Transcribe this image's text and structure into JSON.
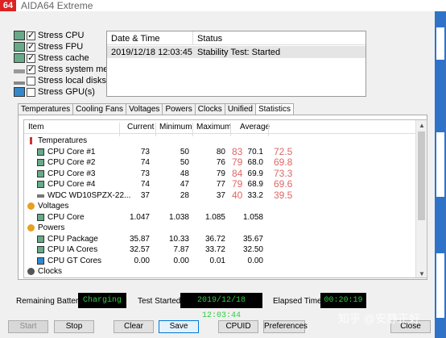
{
  "window": {
    "icon_text": "64",
    "title": "AIDA64 Extreme"
  },
  "stress_options": [
    {
      "label": "Stress CPU",
      "checked": true,
      "device_icon": "cpu-chip-icon"
    },
    {
      "label": "Stress FPU",
      "checked": true,
      "device_icon": "fpu-chip-icon"
    },
    {
      "label": "Stress cache",
      "checked": true,
      "device_icon": "cache-chip-icon"
    },
    {
      "label": "Stress system memory",
      "checked": true,
      "device_icon": "memory-icon"
    },
    {
      "label": "Stress local disks",
      "checked": false,
      "device_icon": "disk-icon"
    },
    {
      "label": "Stress GPU(s)",
      "checked": false,
      "device_icon": "gpu-icon"
    }
  ],
  "log": {
    "col_datetime": "Date & Time",
    "col_status": "Status",
    "rows": [
      {
        "datetime": "2019/12/18 12:03:45",
        "status": "Stability Test: Started"
      }
    ]
  },
  "tabs": [
    "Temperatures",
    "Cooling Fans",
    "Voltages",
    "Powers",
    "Clocks",
    "Unified",
    "Statistics"
  ],
  "active_tab": "Statistics",
  "stats": {
    "columns": {
      "item": "Item",
      "current": "Current",
      "minimum": "Minimum",
      "maximum": "Maximum",
      "average": "Average"
    },
    "rows": [
      {
        "type": "group",
        "name": "Temperatures",
        "icon": "thermometer-icon"
      },
      {
        "type": "item",
        "name": "CPU Core #1",
        "current": "73",
        "min": "50",
        "max": "80",
        "avg": "70.1",
        "note1": "83",
        "note2": "72.5",
        "icon": "cpu-chip-icon"
      },
      {
        "type": "item",
        "name": "CPU Core #2",
        "current": "74",
        "min": "50",
        "max": "76",
        "avg": "68.0",
        "note1": "79",
        "note2": "69.8",
        "icon": "cpu-chip-icon"
      },
      {
        "type": "item",
        "name": "CPU Core #3",
        "current": "73",
        "min": "48",
        "max": "79",
        "avg": "69.9",
        "note1": "84",
        "note2": "73.3",
        "icon": "cpu-chip-icon"
      },
      {
        "type": "item",
        "name": "CPU Core #4",
        "current": "74",
        "min": "47",
        "max": "77",
        "avg": "68.9",
        "note1": "79",
        "note2": "69.6",
        "icon": "cpu-chip-icon"
      },
      {
        "type": "item",
        "name": "WDC WD10SPZX-22...",
        "current": "37",
        "min": "28",
        "max": "37",
        "avg": "33.2",
        "note1": "40",
        "note2": "39.5",
        "icon": "disk-icon"
      },
      {
        "type": "group",
        "name": "Voltages",
        "icon": "voltage-icon"
      },
      {
        "type": "item",
        "name": "CPU Core",
        "current": "1.047",
        "min": "1.038",
        "max": "1.085",
        "avg": "1.058",
        "icon": "cpu-chip-icon"
      },
      {
        "type": "group",
        "name": "Powers",
        "icon": "power-icon"
      },
      {
        "type": "item",
        "name": "CPU Package",
        "current": "35.87",
        "min": "10.33",
        "max": "36.72",
        "avg": "35.67",
        "icon": "cpu-chip-icon"
      },
      {
        "type": "item",
        "name": "CPU IA Cores",
        "current": "32.57",
        "min": "7.87",
        "avg": "32.50",
        "max": "33.72",
        "icon": "cpu-chip-icon"
      },
      {
        "type": "item",
        "name": "CPU GT Cores",
        "current": "0.00",
        "min": "0.00",
        "max": "0.01",
        "avg": "0.00",
        "icon": "gpu-icon"
      },
      {
        "type": "group",
        "name": "Clocks",
        "icon": "clock-icon"
      }
    ]
  },
  "status": {
    "battery_label": "Remaining Battery:",
    "battery_value": "Charging",
    "started_label": "Test Started:",
    "started_value": "2019/12/18 12:03:44",
    "elapsed_label": "Elapsed Time:",
    "elapsed_value": "00:20:19"
  },
  "buttons": {
    "start": "Start",
    "stop": "Stop",
    "clear": "Clear",
    "save": "Save",
    "cpuid": "CPUID",
    "preferences": "Preferences",
    "close": "Close"
  },
  "watermark": "知乎 @安静正好",
  "colors": {
    "annotation": "#e06666",
    "led_text": "#2ecc40",
    "accent": "#0078d7",
    "app_icon": "#dd2222"
  }
}
